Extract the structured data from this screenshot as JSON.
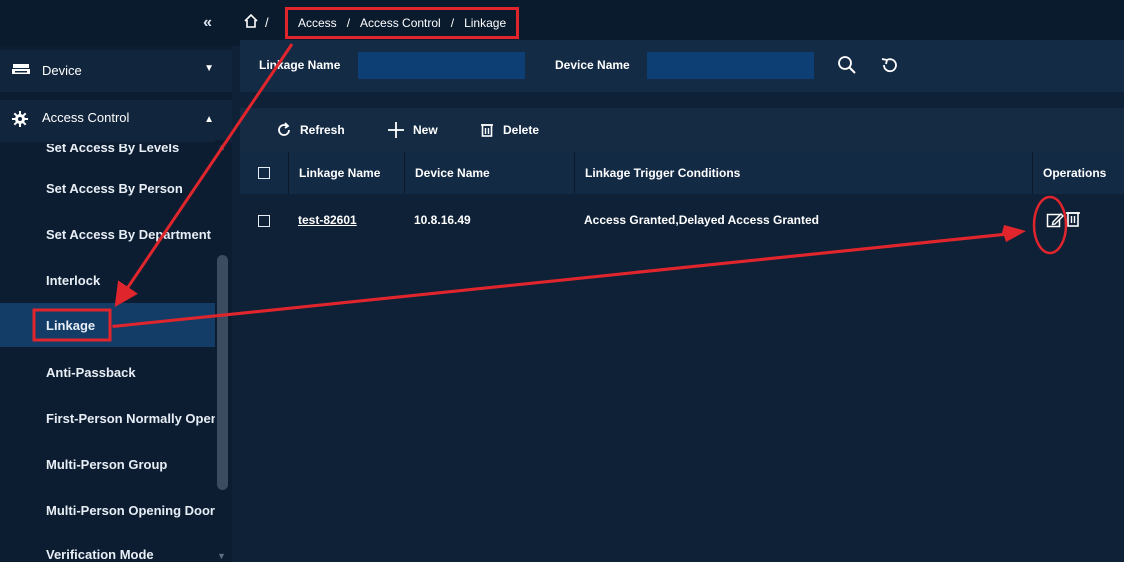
{
  "sidebar": {
    "collapse_icon": "double-chevron-left-icon",
    "groups": [
      {
        "label": "Device",
        "icon": "device-icon",
        "arrow": "chevron-down-icon"
      },
      {
        "label": "Access Control",
        "icon": "gear-icon",
        "arrow": "chevron-up-icon"
      }
    ],
    "items": [
      {
        "label": "Set Access By Levels"
      },
      {
        "label": "Set Access By Person"
      },
      {
        "label": "Set Access By Department"
      },
      {
        "label": "Interlock"
      },
      {
        "label": "Linkage"
      },
      {
        "label": "Anti-Passback"
      },
      {
        "label": "First-Person Normally Open"
      },
      {
        "label": "Multi-Person Group"
      },
      {
        "label": "Multi-Person Opening Door"
      },
      {
        "label": "Verification Mode"
      }
    ]
  },
  "breadcrumb": {
    "home_icon": "home-icon",
    "separator": "/",
    "items": [
      "Access",
      "Access Control",
      "Linkage"
    ]
  },
  "filter": {
    "linkage_name_label": "Linkage Name",
    "linkage_name_value": "",
    "device_name_label": "Device Name",
    "device_name_value": "",
    "search_icon": "search-icon",
    "reset_icon": "reset-icon"
  },
  "toolbar": {
    "refresh_label": "Refresh",
    "new_label": "New",
    "delete_label": "Delete"
  },
  "table": {
    "columns": [
      "Linkage Name",
      "Device Name",
      "Linkage Trigger Conditions",
      "Operations"
    ],
    "rows": [
      {
        "linkage_name": "test-82601",
        "device_name": "10.8.16.49",
        "trigger_conditions": "Access Granted,Delayed Access Granted",
        "operations": [
          "edit-icon",
          "trash-icon"
        ]
      }
    ]
  },
  "colors": {
    "background": "#0f2136",
    "active_item": "#133d67",
    "input": "#0d3f75",
    "annotation": "#e0252d"
  }
}
